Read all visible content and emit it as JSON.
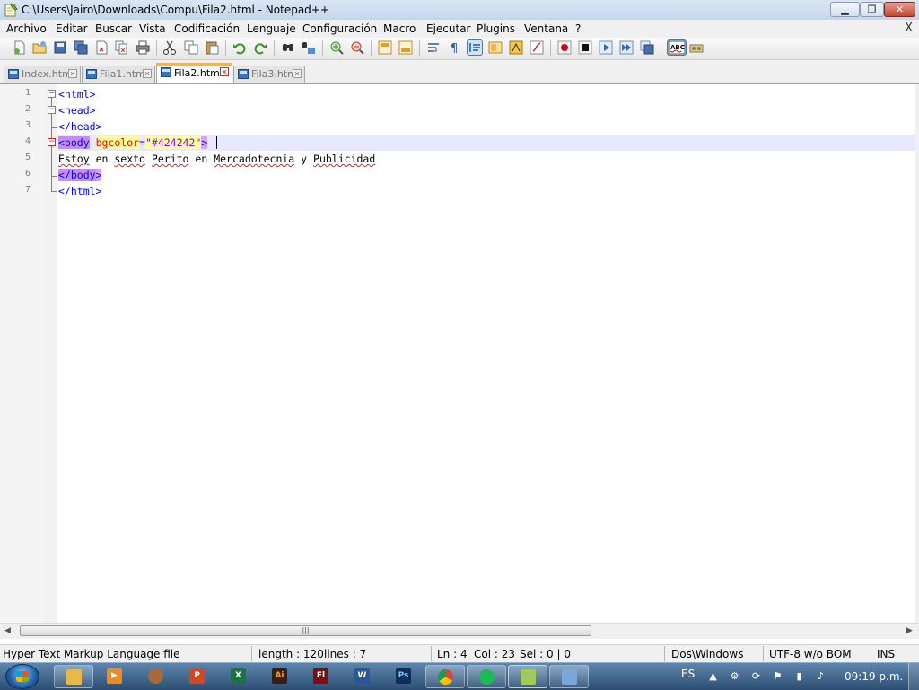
{
  "window": {
    "title": "C:\\Users\\Jairo\\Downloads\\Compu\\Fila2.html - Notepad++",
    "minimize_label": "▭",
    "maximize_label": "❐",
    "close_label": "✕"
  },
  "menubar": {
    "items": [
      "Archivo",
      "Editar",
      "Buscar",
      "Vista",
      "Codificación",
      "Lenguaje",
      "Configuración",
      "Macro",
      "Ejecutar",
      "Plugins",
      "Ventana",
      "?"
    ],
    "close_doc_label": "X"
  },
  "toolbar": {
    "icons": [
      "new-icon",
      "open-icon",
      "save-icon",
      "save-all-icon",
      "close-icon",
      "close-all-icon",
      "print-icon",
      "cut-icon",
      "copy-icon",
      "paste-icon",
      "undo-icon",
      "redo-icon",
      "find-icon",
      "replace-icon",
      "zoom-in-icon",
      "zoom-out-icon",
      "sync-vertical-icon",
      "sync-horizontal-icon",
      "word-wrap-icon",
      "show-all-chars-icon",
      "indent-guide-icon",
      "doc-map-icon",
      "folder-workspace-icon",
      "function-list-icon",
      "record-macro-icon",
      "stop-macro-icon",
      "play-macro-icon",
      "run-macro-multiple-icon",
      "save-macro-icon",
      "spell-check-icon",
      "abc-icon"
    ]
  },
  "tabs": [
    {
      "label": "Index.html",
      "active": false
    },
    {
      "label": "Fila1.html",
      "active": false
    },
    {
      "label": "Fila2.html",
      "active": true
    },
    {
      "label": "Fila3.html",
      "active": false
    }
  ],
  "editor": {
    "line_numbers": [
      "1",
      "2",
      "3",
      "4",
      "5",
      "6",
      "7"
    ],
    "lines": {
      "l1_tag": "<html>",
      "l2_tag": "<head>",
      "l3_tag": "</head>",
      "l4_open": "<body",
      "l4_attr": "bgcolor",
      "l4_eq": "=",
      "l4_val_q1": "\"",
      "l4_val": "#424242",
      "l4_val_q2": "\"",
      "l4_close": ">",
      "l5_w1": "Estoy",
      "l5_w2": "en",
      "l5_w3": "sexto",
      "l5_w4": "Perito",
      "l5_w5": "en",
      "l5_w6": "Mercadotecnia",
      "l5_w7": "y",
      "l5_w8": "Publicidad",
      "l6_tag": "</body",
      "l6_close": ">",
      "l7_tag": "</html>"
    }
  },
  "scrollbar": {
    "thumb_grip": "|||",
    "left_arrow": "◀",
    "right_arrow": "▶"
  },
  "statusbar": {
    "file_type": "Hyper Text Markup Language file",
    "length": "length : 120",
    "lines": "lines : 7",
    "ln": "Ln : 4",
    "col": "Col : 23",
    "sel": "Sel : 0 | 0",
    "eol": "Dos\\Windows",
    "encoding": "UTF-8 w/o BOM",
    "mode": "INS"
  },
  "taskbar": {
    "apps": [
      {
        "name": "explorer-icon",
        "glyph": "",
        "color": "#e8b84a"
      },
      {
        "name": "media-player-icon",
        "glyph": "▶",
        "color": "#f08a1c"
      },
      {
        "name": "gimp-icon",
        "glyph": "",
        "color": "#a86a3a"
      },
      {
        "name": "powerpoint-icon",
        "glyph": "P",
        "color": "#d24726"
      },
      {
        "name": "excel-icon",
        "glyph": "X",
        "color": "#1e7145"
      },
      {
        "name": "illustrator-icon",
        "glyph": "Ai",
        "color": "#3b1d0f"
      },
      {
        "name": "flash-icon",
        "glyph": "Fl",
        "color": "#7a0f0f"
      },
      {
        "name": "word-icon",
        "glyph": "W",
        "color": "#2b579a"
      },
      {
        "name": "photoshop-icon",
        "glyph": "Ps",
        "color": "#0e2e57"
      },
      {
        "name": "chrome-icon",
        "glyph": "",
        "color": "#e9a222"
      },
      {
        "name": "spotify-icon",
        "glyph": "",
        "color": "#1db954"
      },
      {
        "name": "notepad-plus-plus-icon",
        "glyph": "",
        "color": "#9fcb5e"
      },
      {
        "name": "paint-icon",
        "glyph": "",
        "color": "#7aa7d8"
      }
    ],
    "language": "ES",
    "clock": "09:19 p.m."
  }
}
